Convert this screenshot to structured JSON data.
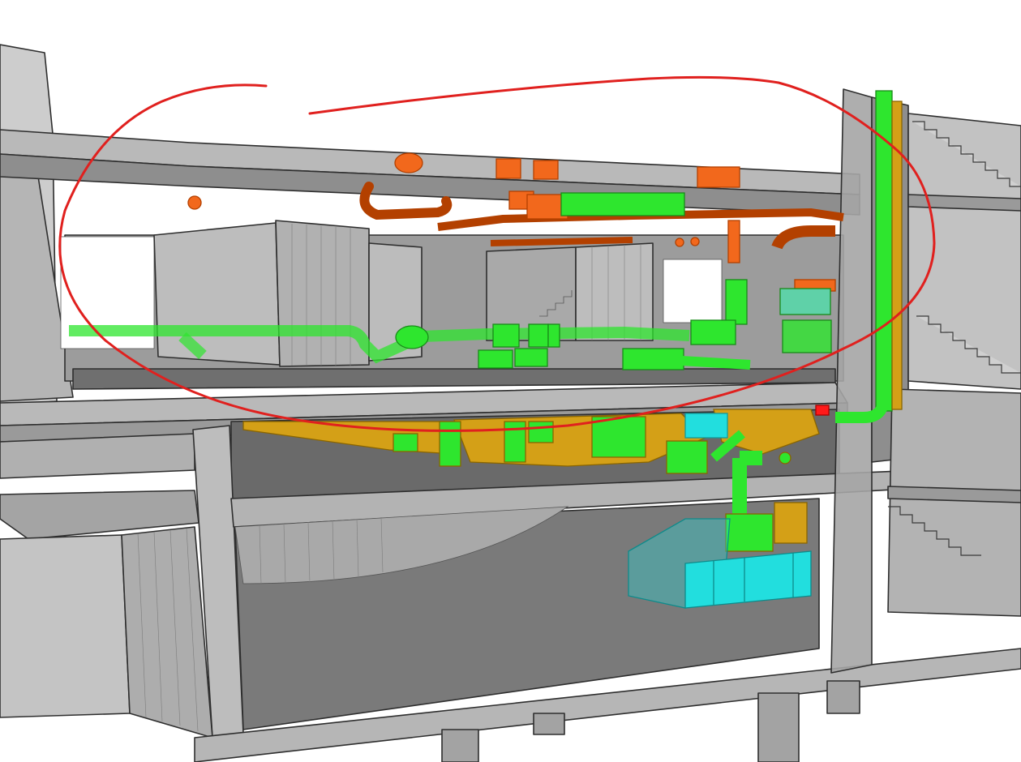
{
  "view": {
    "kind": "3d-section-view",
    "subject": "building-services-coordination-model"
  },
  "colors": {
    "background": "#ffffff",
    "concrete_light": "#c8c8c8",
    "concrete_mid": "#a9a9a9",
    "concrete_dark": "#6e6e6e",
    "slab_top": "#9a9a9a",
    "ventilation_supply": "#2ee62e",
    "ventilation_supply_dark": "#1faa1f",
    "sprinkler_heating": "#f2681c",
    "sprinkler_heating_dark": "#b34700",
    "duct_insulation": "#d4a017",
    "duct_insulation_dark": "#9a7300",
    "water_tank": "#22dede",
    "water_tank_dark": "#129a9a",
    "markup": "#e0201e",
    "alert": "#ff1a1a"
  },
  "markup": {
    "shape": "freehand-loop",
    "meaning": "highlighted-clash-zone"
  },
  "systems": [
    {
      "id": "orange-network",
      "color_key": "sprinkler_heating",
      "level": "ceiling-upper"
    },
    {
      "id": "green-network-upper",
      "color_key": "ventilation_supply",
      "level": "floor-upper"
    },
    {
      "id": "green-yellow-network-lower",
      "color_key": "duct_insulation",
      "level": "ceiling-lower"
    },
    {
      "id": "cyan-tank",
      "color_key": "water_tank",
      "level": "basement"
    }
  ]
}
